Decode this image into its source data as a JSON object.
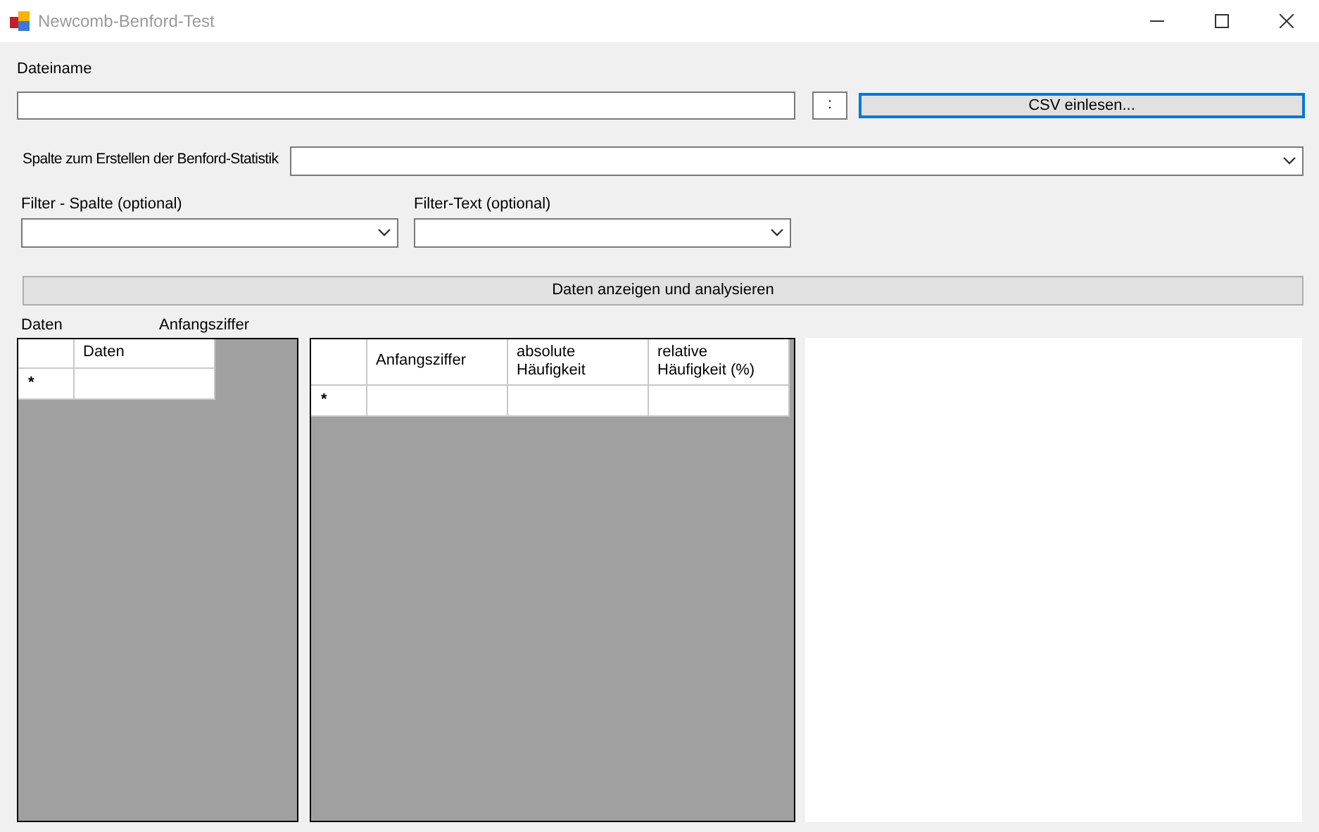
{
  "window": {
    "title": "Newcomb-Benford-Test"
  },
  "file": {
    "label": "Dateiname",
    "separator_button": ":",
    "read_button": "CSV einlesen..."
  },
  "column_select": {
    "label": "Spalte zum Erstellen der Benford-Statistik"
  },
  "filters": [
    {
      "label": "Filter - Spalte (optional)"
    },
    {
      "label": "Filter-Text (optional)"
    }
  ],
  "analyze_button": "Daten anzeigen und analysieren",
  "grid_labels": [
    "Daten",
    "Anfangsziffer"
  ],
  "grids": [
    {
      "columns": [
        "Daten"
      ],
      "new_row_marker": "*"
    },
    {
      "columns": [
        "Anfangsziffer",
        "absolute\nHäufigkeit",
        "relative\nHäufigkeit (%)"
      ],
      "new_row_marker": "*"
    }
  ]
}
